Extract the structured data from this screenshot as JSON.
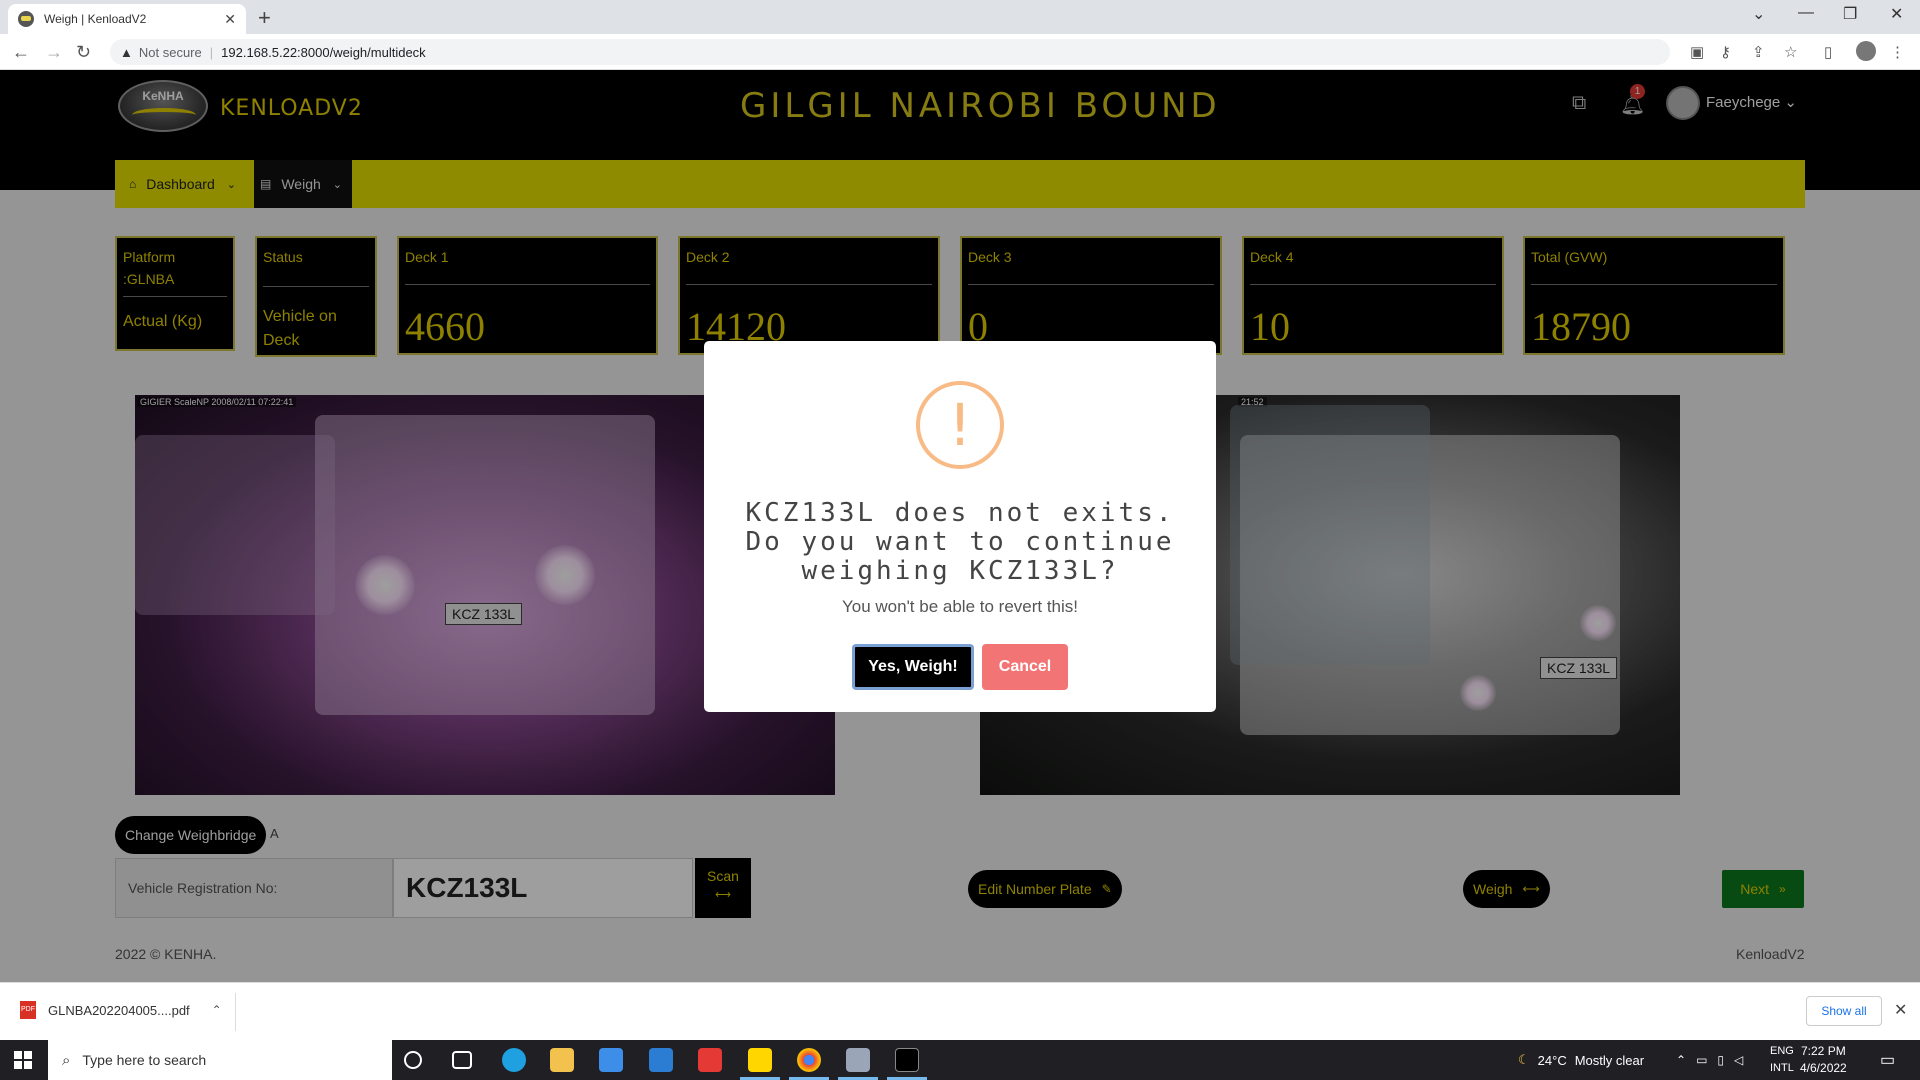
{
  "browser": {
    "tab_title": "Weigh | KenloadV2",
    "tab_close": "✕",
    "new_tab": "+",
    "security_label": "Not secure",
    "url": "192.168.5.22:8000/weigh/multideck"
  },
  "header": {
    "logo_text": "KeNHA",
    "brand": "KENLOADV2",
    "station_title": "GILGIL NAIROBI BOUND",
    "notification_count": "1",
    "username": "Faeychege"
  },
  "menu": {
    "items": [
      {
        "label": "Dashboard",
        "icon": "home-icon"
      },
      {
        "label": "Weigh",
        "icon": "scale-icon"
      }
    ]
  },
  "readings": {
    "platform": {
      "label": "Platform",
      "code": ":GLNBA",
      "sub": "Actual (Kg)"
    },
    "status": {
      "label": "Status",
      "value": "Vehicle on Deck"
    },
    "decks": [
      {
        "label": "Deck 1",
        "value": "4660"
      },
      {
        "label": "Deck 2",
        "value": "14120"
      },
      {
        "label": "Deck 3",
        "value": "0"
      },
      {
        "label": "Deck 4",
        "value": "10"
      },
      {
        "label": "Total (GVW)",
        "value": "18790"
      }
    ]
  },
  "cameras": {
    "left": {
      "stamp": "GIGIER ScaleNP 2008/02/11 07:22:41",
      "plate": "KCZ 133L"
    },
    "right": {
      "stamp": "21:52",
      "plate": "KCZ 133L"
    }
  },
  "controls": {
    "change_weighbridge": "Change Weighbridge",
    "change_weighbridge_suffix": "A",
    "registration_label": "Vehicle Registration No:",
    "registration_value": "KCZ133L",
    "scan_label": "Scan",
    "scan_icon": "⟷",
    "edit_plate_label": "Edit Number Plate",
    "edit_icon": "✎",
    "weigh_label": "Weigh",
    "weigh_icon": "⟷",
    "next_label": "Next",
    "next_icon": "»"
  },
  "footer": {
    "copyright": "2022 © KENHA.",
    "app_name": "KenloadV2"
  },
  "modal": {
    "icon": "!",
    "title": "KCZ133L does not exits. Do you want to continue weighing KCZ133L?",
    "text": "You won't be able to revert this!",
    "confirm_label": "Yes, Weigh!",
    "cancel_label": "Cancel"
  },
  "downloads": {
    "file_name": "GLNBA202204005....pdf",
    "file_type": "PDF",
    "show_all": "Show all"
  },
  "taskbar": {
    "search_placeholder": "Type here to search",
    "weather_temp": "24°C",
    "weather_desc": "Mostly clear",
    "lang_top": "ENG",
    "lang_bottom": "INTL",
    "time": "7:22 PM",
    "date": "4/6/2022"
  },
  "colors": {
    "accent_yellow": "#e5d100",
    "menubar_yellow": "#e5e100",
    "next_green": "#0e7a1e",
    "warning_orange": "#f8bb86",
    "cancel_red": "#f27474"
  }
}
